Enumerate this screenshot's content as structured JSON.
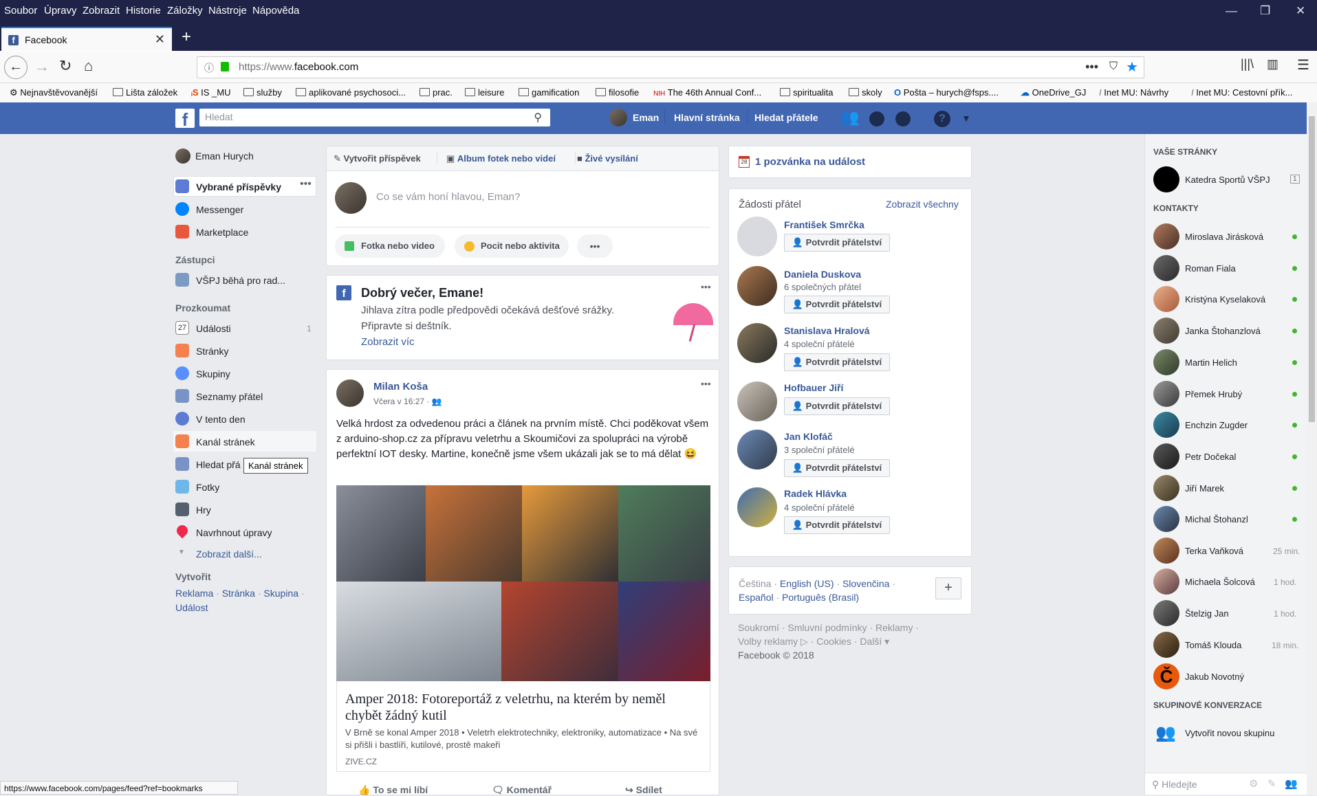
{
  "menubar": [
    "Soubor",
    "Úpravy",
    "Zobrazit",
    "Historie",
    "Záložky",
    "Nástroje",
    "Nápověda"
  ],
  "tab": {
    "title": "Facebook"
  },
  "url": {
    "prefix": "https://www.",
    "domain": "facebook.com"
  },
  "bookmarks": [
    "Nejnavštěvovanější",
    "Lišta záložek",
    "IS _MU",
    "služby",
    "aplikované psychosoci...",
    "prac.",
    "leisure",
    "gamification",
    "filosofie",
    "The 46th Annual Conf...",
    "spiritualita",
    "skoly",
    "Pošta – hurych@fsps....",
    "OneDrive_GJ",
    "Inet MU: Návrhy",
    "Inet MU: Cestovní přík..."
  ],
  "fb": {
    "search_placeholder": "Hledat",
    "top": {
      "user": "Eman",
      "home": "Hlavní stránka",
      "find": "Hledat přátele"
    },
    "left": {
      "user": "Eman Hurych",
      "items": [
        "Vybrané příspěvky",
        "Messenger",
        "Marketplace"
      ],
      "zastupci_h": "Zástupci",
      "zastupci": "VŠPJ běhá pro rad...",
      "explore_h": "Prozkoumat",
      "explore": [
        "Události",
        "Stránky",
        "Skupiny",
        "Seznamy přátel",
        "V tento den",
        "Kanál stránek",
        "Hledat přá",
        "Fotky",
        "Hry",
        "Navrhnout úpravy"
      ],
      "events_count": "1",
      "more": "Zobrazit další...",
      "create_h": "Vytvořit",
      "create_links": [
        "Reklama",
        "Stránka",
        "Skupina",
        "Událost"
      ],
      "tooltip": "Kanál stránek"
    },
    "composer": {
      "tabs": [
        "Vytvořit příspěvek",
        "Album fotek nebo videí",
        "Živé vysílání"
      ],
      "placeholder": "Co se vám honí hlavou, Eman?",
      "btns": [
        "Fotka nebo video",
        "Pocit nebo aktivita"
      ]
    },
    "greeting": {
      "title": "Dobrý večer, Emane!",
      "line1": "Jihlava zítra podle předpovědi očekává dešťové srážky.",
      "line2": "Připravte si deštník.",
      "more": "Zobrazit víc"
    },
    "post": {
      "author": "Milan Koša",
      "time": "Včera v 16:27 ·",
      "text": "Velká hrdost za odvedenou práci a článek na prvním místě. Chci poděkovat všem z arduino-shop.cz za přípravu veletrhu a Skoumičovi za spolupráci na výrobě perfektní IOT desky. Martine, konečně jsme všem ukázali jak se to má dělat 😆",
      "link_title": "Amper 2018: Fotoreportáž z veletrhu, na kterém by neměl chybět žádný kutil",
      "link_desc": "V Brně se konal Amper 2018 • Veletrh elektrotechniky, elektroniky, automatizace • Na své si přišli i bastlíři, kutilové, prostě makeři",
      "link_src": "ZIVE.CZ",
      "actions": [
        "To se mi líbí",
        "Komentář",
        "Sdílet"
      ]
    },
    "events": {
      "label": "1 pozvánka na událost",
      "icon_num": "28"
    },
    "requests": {
      "title": "Žádosti přátel",
      "see_all": "Zobrazit všechny",
      "confirm": "Potvrdit přátelství",
      "people": [
        {
          "name": "František Smrčka",
          "sub": ""
        },
        {
          "name": "Daniela Duskova",
          "sub": "6 společných přátel"
        },
        {
          "name": "Stanislava Hralová",
          "sub": "4 společní přátelé"
        },
        {
          "name": "Hofbauer Jiří",
          "sub": ""
        },
        {
          "name": "Jan Klofáč",
          "sub": "3 společní přátelé"
        },
        {
          "name": "Radek Hlávka",
          "sub": "4 společní přátelé"
        }
      ]
    },
    "lang": {
      "l1": "Čeština",
      "l2": "English (US)",
      "l3": "Slovenčina",
      "l4": "Español",
      "l5": "Português (Brasil)",
      "plus": "+"
    },
    "footer": {
      "a": "Soukromí",
      "b": "Smluvní podmínky",
      "c": "Reklamy",
      "d": "Volby reklamy",
      "e": "Cookies",
      "f": "Další",
      "copy": "Facebook © 2018"
    },
    "right": {
      "pages_h": "VAŠE STRÁNKY",
      "page": "Katedra Sportů VŠPJ",
      "page_count": "1",
      "contacts_h": "KONTAKTY",
      "contacts": [
        {
          "name": "Miroslava Jirásková",
          "time": ""
        },
        {
          "name": "Roman Fiala",
          "time": ""
        },
        {
          "name": "Kristýna Kyselaková",
          "time": ""
        },
        {
          "name": "Janka Štohanzlová",
          "time": ""
        },
        {
          "name": "Martin Helich",
          "time": ""
        },
        {
          "name": "Přemek Hrubý",
          "time": ""
        },
        {
          "name": "Enchzin Zugder",
          "time": ""
        },
        {
          "name": "Petr Dočekal",
          "time": ""
        },
        {
          "name": "Jiří Marek",
          "time": ""
        },
        {
          "name": "Michal Štohanzl",
          "time": ""
        },
        {
          "name": "Terka Vaňková",
          "time": "25 min."
        },
        {
          "name": "Michaela Šolcová",
          "time": "1 hod."
        },
        {
          "name": "Štelzig Jan",
          "time": "1 hod."
        },
        {
          "name": "Tomáš Klouda",
          "time": "18 min."
        },
        {
          "name": "Jakub Novotný",
          "time": ""
        }
      ],
      "groups_h": "SKUPINOVÉ KONVERZACE",
      "new_group": "Vytvořit novou skupinu",
      "search_ph": "Hledejte"
    }
  },
  "status": "https://www.facebook.com/pages/feed?ref=bookmarks"
}
